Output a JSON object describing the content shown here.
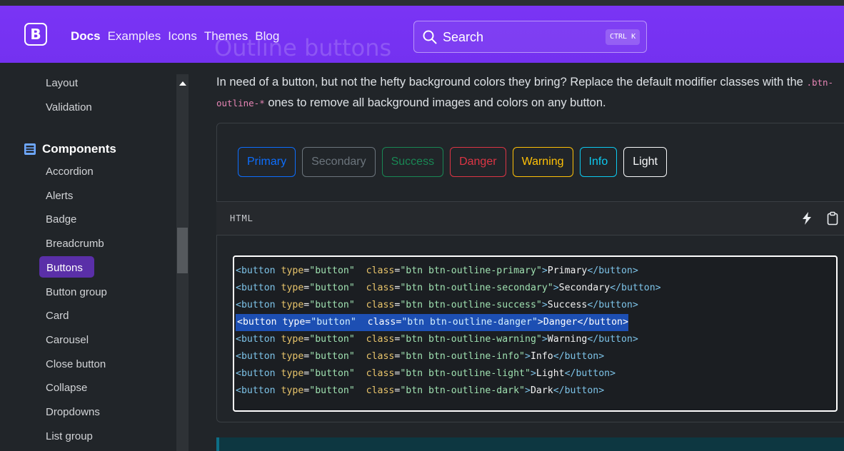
{
  "nav": {
    "brand": "B",
    "links": [
      "Docs",
      "Examples",
      "Icons",
      "Themes",
      "Blog"
    ],
    "bleed_heading": "Outline buttons",
    "search_placeholder": "Search",
    "search_shortcut": "CTRL K"
  },
  "sidebar": {
    "items_above": [
      "Layout",
      "Validation"
    ],
    "group_label": "Components",
    "items": [
      "Accordion",
      "Alerts",
      "Badge",
      "Breadcrumb",
      "Buttons",
      "Button group",
      "Card",
      "Carousel",
      "Close button",
      "Collapse",
      "Dropdowns",
      "List group"
    ],
    "active": "Buttons"
  },
  "main": {
    "lead_before": "In need of a button, but not the hefty background colors they bring? Replace the default modifier classes with the ",
    "lead_code": ".btn-outline-*",
    "lead_after": " ones to remove all background images and colors on any button."
  },
  "example": {
    "buttons": [
      {
        "label": "Primary",
        "color": "#0d6efd"
      },
      {
        "label": "Secondary",
        "color": "#6c757d"
      },
      {
        "label": "Success",
        "color": "#198754"
      },
      {
        "label": "Danger",
        "color": "#dc3545"
      },
      {
        "label": "Warning",
        "color": "#ffc107"
      },
      {
        "label": "Info",
        "color": "#0dcaf0"
      },
      {
        "label": "Light",
        "color": "#f8f9fa"
      }
    ]
  },
  "snippet": {
    "language": "HTML",
    "icons": [
      "bolt-icon",
      "clipboard-icon"
    ],
    "highlighted_line": 3,
    "lines": [
      {
        "cls": "btn btn-outline-primary",
        "text": "Primary"
      },
      {
        "cls": "btn btn-outline-secondary",
        "text": "Secondary"
      },
      {
        "cls": "btn btn-outline-success",
        "text": "Success"
      },
      {
        "cls": "btn btn-outline-danger",
        "text": "Danger"
      },
      {
        "cls": "btn btn-outline-warning",
        "text": "Warning"
      },
      {
        "cls": "btn btn-outline-info",
        "text": "Info"
      },
      {
        "cls": "btn btn-outline-light",
        "text": "Light"
      },
      {
        "cls": "btn btn-outline-dark",
        "text": "Dark"
      }
    ],
    "tag_open": "<button",
    "attr_type": "type",
    "type_value": "\"button\"",
    "attr_class": "class",
    "tag_close": "</button>"
  }
}
